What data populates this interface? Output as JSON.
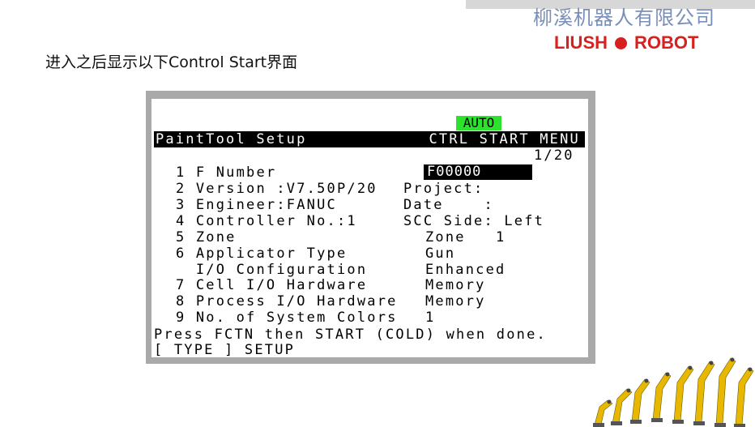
{
  "header": {
    "company_cn": "柳溪机器人有限公司",
    "company_en_left": "LIUSH",
    "company_en_right": "ROBOT"
  },
  "caption": "进入之后显示以下Control Start界面",
  "pendant": {
    "status": "AUTO",
    "title_left": "PaintTool Setup",
    "title_right": "CTRL START MENU",
    "page": "1/20",
    "lines": [
      {
        "left": "1 F Number",
        "right": ""
      },
      {
        "left": "2 Version :V7.50P/20",
        "right": "Project:"
      },
      {
        "left": "3 Engineer:FANUC",
        "right": "Date    :"
      },
      {
        "left": "4 Controller No.:1",
        "right": "SCC Side: Left"
      },
      {
        "left": "5 Zone",
        "right": "Zone   1"
      },
      {
        "left": "6 Applicator Type",
        "right": "Gun"
      },
      {
        "left": "  I/O Configuration",
        "right": "Enhanced"
      },
      {
        "left": "7 Cell I/O Hardware",
        "right": "Memory"
      },
      {
        "left": "8 Process I/O Hardware",
        "right": "Memory"
      },
      {
        "left": "9 No. of System Colors",
        "right": "1"
      }
    ],
    "f_number_value": "F00000",
    "prompt": "Press FCTN then START (COLD) when done.",
    "function_keys": "[ TYPE ] SETUP"
  },
  "colors": {
    "status_green": "#2de22d",
    "brand_red": "#d8201e",
    "brand_blue": "#7a8fb8",
    "frame_gray": "#a9a9a9"
  }
}
